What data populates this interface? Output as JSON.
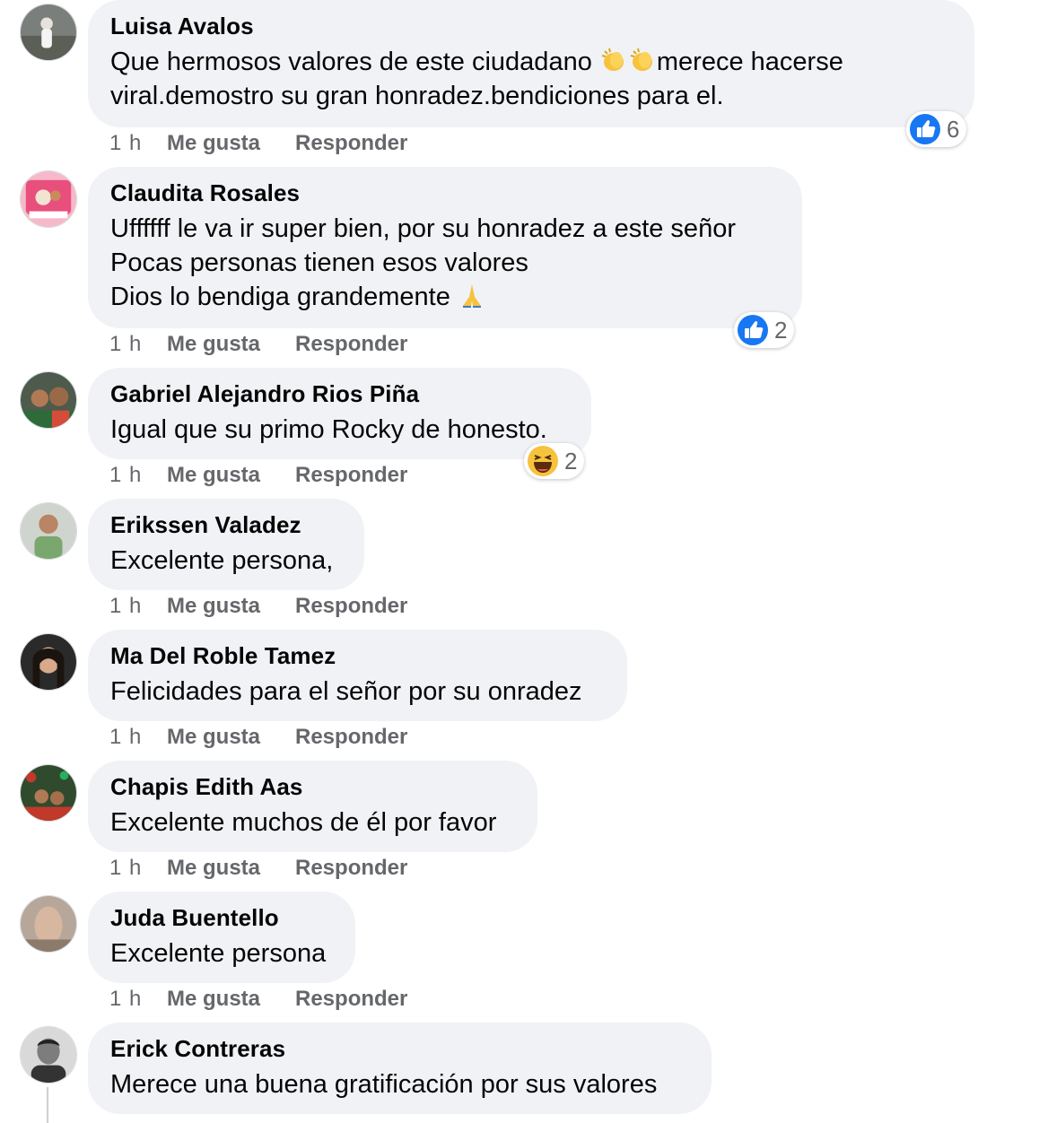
{
  "colors": {
    "bubble": "#f0f2f5",
    "meta": "#65676b",
    "like_blue": "#1877f2",
    "text": "#050505"
  },
  "comments": [
    {
      "author": "Luisa Avalos",
      "text_before": "Que hermosos valores de este ciudadano ",
      "text_after": "merece hacerse\nviral.demostro su gran honradez.bendiciones para el.",
      "emojis": [
        "clapping-hands",
        "clapping-hands"
      ],
      "time": "1 h",
      "like": "Me gusta",
      "reply": "Responder",
      "reaction_icon": "like-icon",
      "reaction_count": "6"
    },
    {
      "author": "Claudita Rosales",
      "text": "Uffffff le va ir super bien, por su honradez a este señor\nPocas personas tienen esos valores\nDios lo bendiga grandemente ",
      "emojis": [
        "folded-hands"
      ],
      "time": "1 h",
      "like": "Me gusta",
      "reply": "Responder",
      "reaction_icon": "like-icon",
      "reaction_count": "2"
    },
    {
      "author": "Gabriel Alejandro Rios Piña",
      "text": "Igual que su primo Rocky de honesto.",
      "time": "1 h",
      "like": "Me gusta",
      "reply": "Responder",
      "reaction_icon": "haha-icon",
      "reaction_count": "2"
    },
    {
      "author": "Erikssen Valadez",
      "text": "Excelente persona,",
      "time": "1 h",
      "like": "Me gusta",
      "reply": "Responder"
    },
    {
      "author": "Ma Del Roble Tamez",
      "text": "Felicidades para el señor por su onradez",
      "time": "1 h",
      "like": "Me gusta",
      "reply": "Responder"
    },
    {
      "author": "Chapis Edith Aas",
      "text": "Excelente muchos de él por favor",
      "time": "1 h",
      "like": "Me gusta",
      "reply": "Responder"
    },
    {
      "author": "Juda Buentello",
      "text": "Excelente persona",
      "time": "1 h",
      "like": "Me gusta",
      "reply": "Responder"
    },
    {
      "author": "Erick Contreras",
      "text": "Merece una buena gratificación por sus valores"
    }
  ]
}
